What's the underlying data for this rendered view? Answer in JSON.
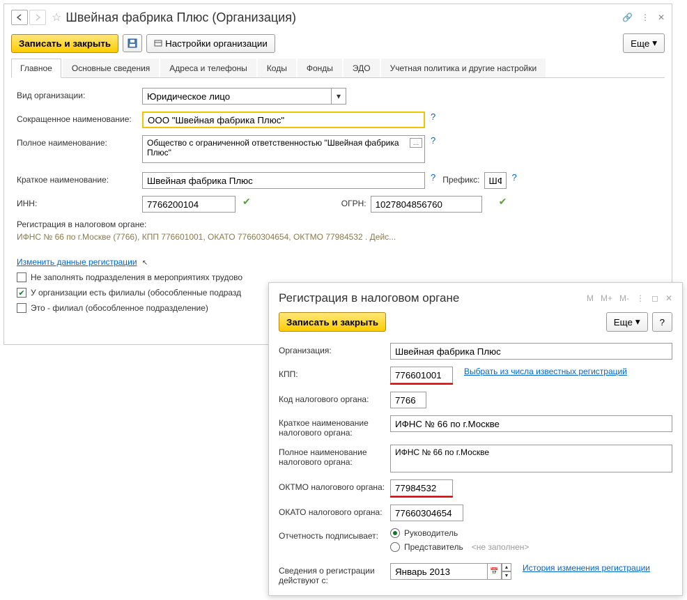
{
  "main": {
    "title": "Швейная фабрика Плюс (Организация)",
    "toolbar": {
      "save_close": "Записать и закрыть",
      "settings": "Настройки организации",
      "more": "Еще"
    },
    "tabs": [
      "Главное",
      "Основные сведения",
      "Адреса и телефоны",
      "Коды",
      "Фонды",
      "ЭДО",
      "Учетная политика и другие настройки"
    ],
    "form": {
      "org_type_label": "Вид организации:",
      "org_type_value": "Юридическое лицо",
      "short_name_label": "Сокращенное наименование:",
      "short_name_value": "ООО \"Швейная фабрика Плюс\"",
      "full_name_label": "Полное наименование:",
      "full_name_value": "Общество с ограниченной ответственностью \"Швейная фабрика Плюс\"",
      "brief_name_label": "Краткое наименование:",
      "brief_name_value": "Швейная фабрика Плюс",
      "prefix_label": "Префикс:",
      "prefix_value": "ШФ",
      "inn_label": "ИНН:",
      "inn_value": "7766200104",
      "ogrn_label": "ОГРН:",
      "ogrn_value": "1027804856760",
      "tax_reg_label": "Регистрация в налоговом органе:",
      "tax_reg_info": "ИФНС № 66 по г.Москве (7766), КПП 776601001, ОКАТО 77660304654, ОКТМО 77984532 . Дейс...",
      "change_reg_link": "Изменить данные регистрации",
      "cb1": "Не заполнять подразделения в мероприятиях трудово",
      "cb2": "У организации есть филиалы (обособленные подразд",
      "cb3": "Это - филиал (обособленное подразделение)"
    }
  },
  "dialog": {
    "title": "Регистрация в налоговом органе",
    "btns": {
      "m": "M",
      "mp": "M+",
      "mm": "M-"
    },
    "save_close": "Записать и закрыть",
    "more": "Еще",
    "help": "?",
    "org_label": "Организация:",
    "org_value": "Швейная фабрика Плюс",
    "kpp_label": "КПП:",
    "kpp_value": "776601001",
    "select_link": "Выбрать из числа известных регистраций",
    "code_label": "Код налогового органа:",
    "code_value": "7766",
    "short_tax_label": "Краткое наименование налогового органа:",
    "short_tax_value": "ИФНС № 66 по г.Москве",
    "full_tax_label": "Полное наименование налогового органа:",
    "full_tax_value": "ИФНС № 66 по г.Москве",
    "oktmo_label": "ОКТМО налогового органа:",
    "oktmo_value": "77984532",
    "okato_label": "ОКАТО налогового органа:",
    "okato_value": "77660304654",
    "signs_label": "Отчетность подписывает:",
    "radio1": "Руководитель",
    "radio2": "Представитель",
    "rep_placeholder": "<не заполнен>",
    "valid_from_label": "Сведения о регистрации действуют с:",
    "valid_from_value": "Январь 2013",
    "history_link": "История изменения регистрации"
  }
}
